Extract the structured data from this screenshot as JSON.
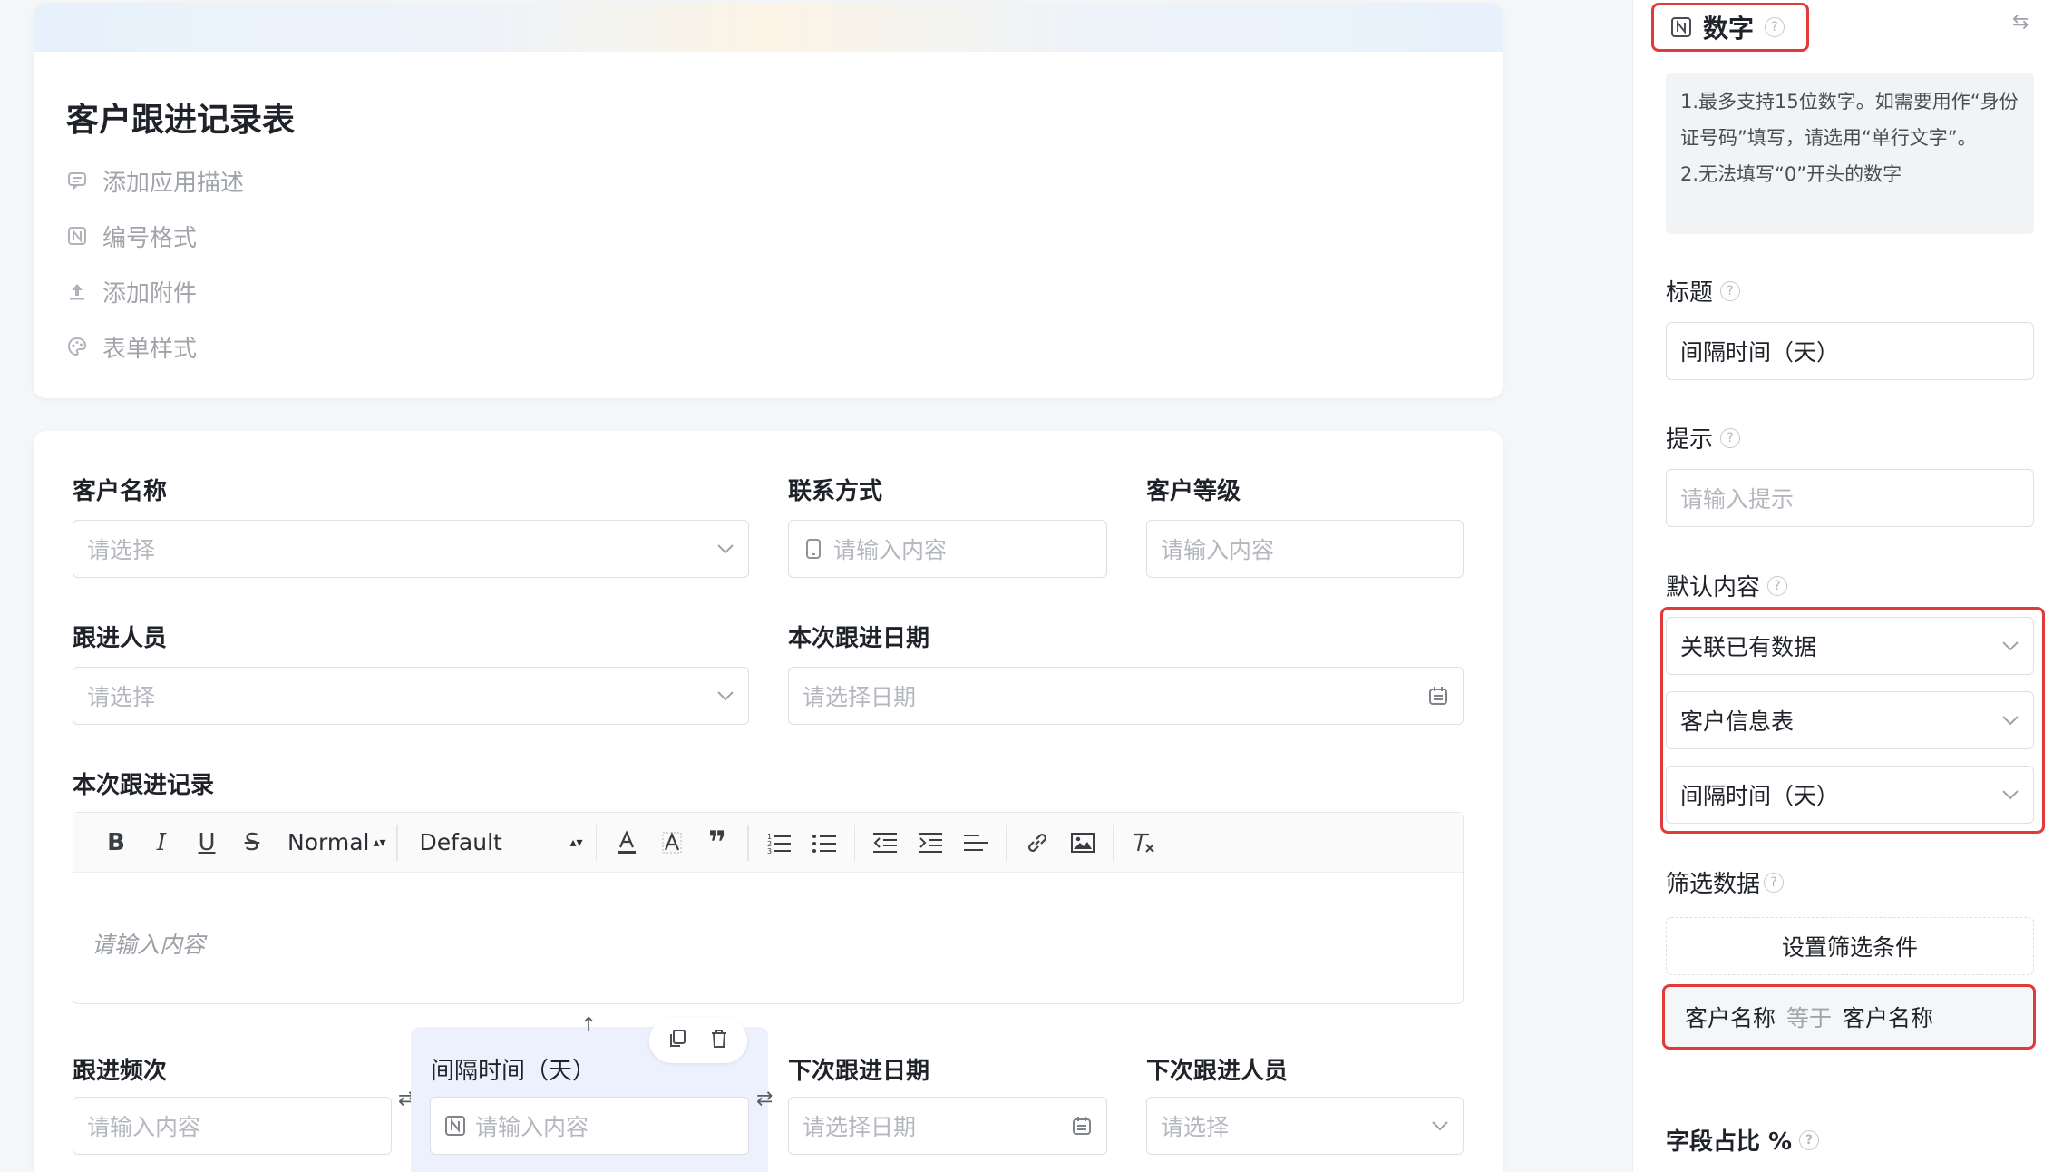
{
  "header": {
    "title": "客户跟进记录表",
    "items": [
      {
        "label": "添加应用描述",
        "icon": "comment-icon"
      },
      {
        "label": "编号格式",
        "icon": "number-format-icon"
      },
      {
        "label": "添加附件",
        "icon": "upload-icon"
      },
      {
        "label": "表单样式",
        "icon": "palette-icon"
      }
    ]
  },
  "form": {
    "customer_name": {
      "label": "客户名称",
      "placeholder": "请选择"
    },
    "contact": {
      "label": "联系方式",
      "placeholder": "请输入内容"
    },
    "customer_level": {
      "label": "客户等级",
      "placeholder": "请输入内容"
    },
    "follower": {
      "label": "跟进人员",
      "placeholder": "请选择"
    },
    "follow_date": {
      "label": "本次跟进日期",
      "placeholder": "请选择日期"
    },
    "record": {
      "label": "本次跟进记录",
      "placeholder": "请输入内容",
      "toolbar": {
        "header_select": "Normal",
        "font_select": "Default"
      }
    },
    "frequency": {
      "label": "跟进频次",
      "placeholder": "请输入内容"
    },
    "interval": {
      "label": "间隔时间（天）",
      "placeholder": "请输入内容"
    },
    "next_date": {
      "label": "下次跟进日期",
      "placeholder": "请选择日期"
    },
    "next_person": {
      "label": "下次跟进人员",
      "placeholder": "请选择"
    }
  },
  "panel": {
    "field_type": "数字",
    "notice": {
      "line1": "1.最多支持15位数字。如需要用作“身份证号码”填写，请选用“单行文字”。",
      "line2": "2.无法填写“0”开头的数字"
    },
    "title_label": "标题",
    "title_value": "间隔时间（天）",
    "hint_label": "提示",
    "hint_placeholder": "请输入提示",
    "default_label": "默认内容",
    "default_mode": "关联已有数据",
    "default_table": "客户信息表",
    "default_field": "间隔时间（天）",
    "filter_label": "筛选数据",
    "filter_button": "设置筛选条件",
    "condition": {
      "left": "客户名称",
      "op": "等于",
      "right": "客户名称"
    },
    "ratio_label": "字段占比 %"
  },
  "colors": {
    "accent": "#3a6ff7",
    "highlight_red": "#e03a3a",
    "selected_bg": "#edf1fd"
  }
}
